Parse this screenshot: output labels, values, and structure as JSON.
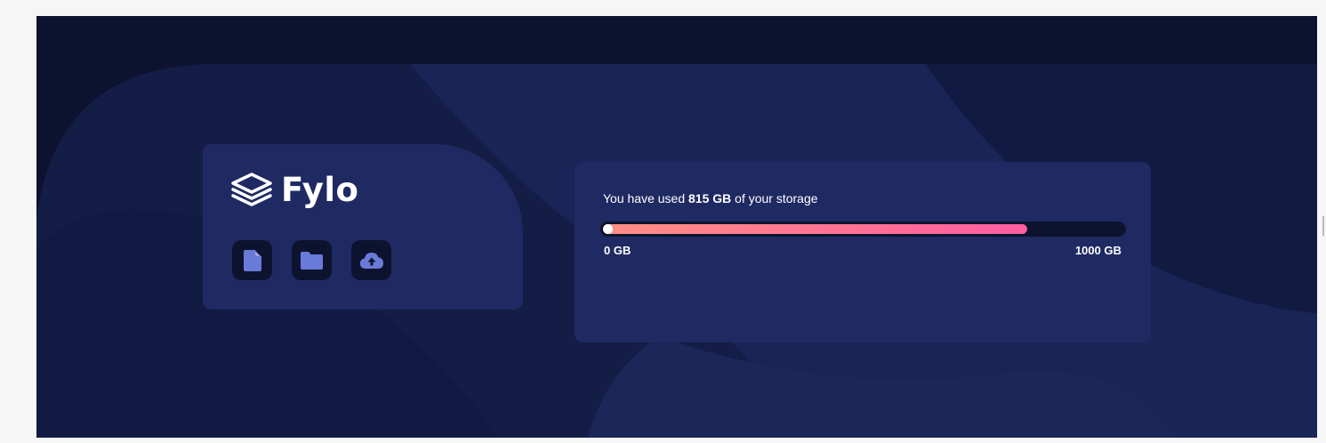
{
  "brand": {
    "name": "Fylo",
    "logo_icon": "stacked-layers-icon"
  },
  "actions": [
    {
      "name": "document-icon",
      "color": "#6a7ad8"
    },
    {
      "name": "folder-icon",
      "color": "#6a7ad8"
    },
    {
      "name": "cloud-upload-icon",
      "color": "#6a7ad8"
    }
  ],
  "storage": {
    "prefix": "You have used ",
    "used": "815 GB",
    "suffix": " of your storage",
    "used_fraction": 0.815,
    "min_label": "0 GB",
    "max_label": "1000 GB"
  },
  "colors": {
    "background": "#0d132f",
    "card": "#1f2a63",
    "gradient_start": "#fe8f84",
    "gradient_end": "#fd5da0"
  }
}
